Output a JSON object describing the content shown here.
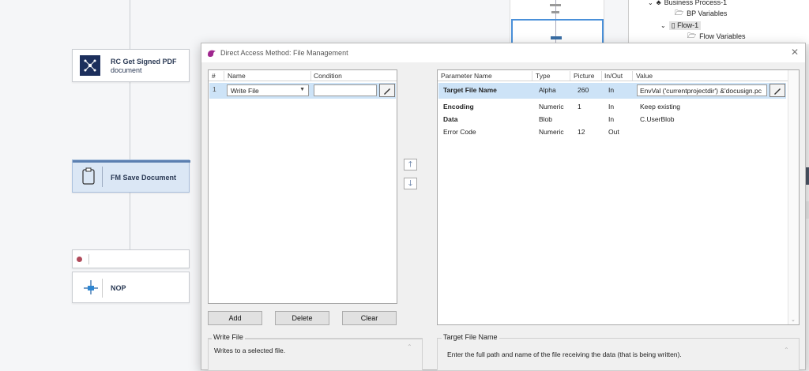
{
  "canvas": {
    "nodes": [
      {
        "label": "RC Get Signed PDF document",
        "line1": "RC Get Signed PDF",
        "line2": "document",
        "icon": "network-icon"
      },
      {
        "label": "FM Save Document",
        "icon": "clipboard-icon"
      },
      {
        "label": "NOP",
        "icon": "nop-icon"
      }
    ]
  },
  "tree": {
    "items": [
      {
        "label": "Business Process-1"
      },
      {
        "label": "BP Variables"
      },
      {
        "label": "Flow-1"
      },
      {
        "label": "Flow Variables"
      }
    ]
  },
  "dialog": {
    "title": "Direct Access Method: File Management",
    "left_table": {
      "headers": [
        "#",
        "Name",
        "Condition"
      ],
      "rows": [
        {
          "num": "1",
          "name": "Write File",
          "condition": ""
        }
      ]
    },
    "buttons": {
      "add": "Add",
      "delete": "Delete",
      "clear": "Clear"
    },
    "move_up": "🡑",
    "move_down": "🡓",
    "right_table": {
      "headers": [
        "Parameter Name",
        "Type",
        "Picture",
        "In/Out",
        "Value"
      ],
      "rows": [
        {
          "name": "Target File Name",
          "type": "Alpha",
          "picture": "260",
          "inout": "In",
          "value": "EnvVal ('currentprojectdir') &'docusign.pc"
        },
        {
          "name": "Encoding",
          "type": "Numeric",
          "picture": "1",
          "inout": "In",
          "value": "Keep existing"
        },
        {
          "name": "Data",
          "type": "Blob",
          "picture": "",
          "inout": "In",
          "value": "C.UserBlob"
        },
        {
          "name": "Error Code",
          "type": "Numeric",
          "picture": "12",
          "inout": "Out",
          "value": ""
        }
      ]
    },
    "left_desc": {
      "title": "Write File",
      "text": "Writes to a selected file."
    },
    "right_desc": {
      "title": "Target File Name",
      "text": "Enter the full path and name of the file receiving the data (that is being written)."
    }
  }
}
